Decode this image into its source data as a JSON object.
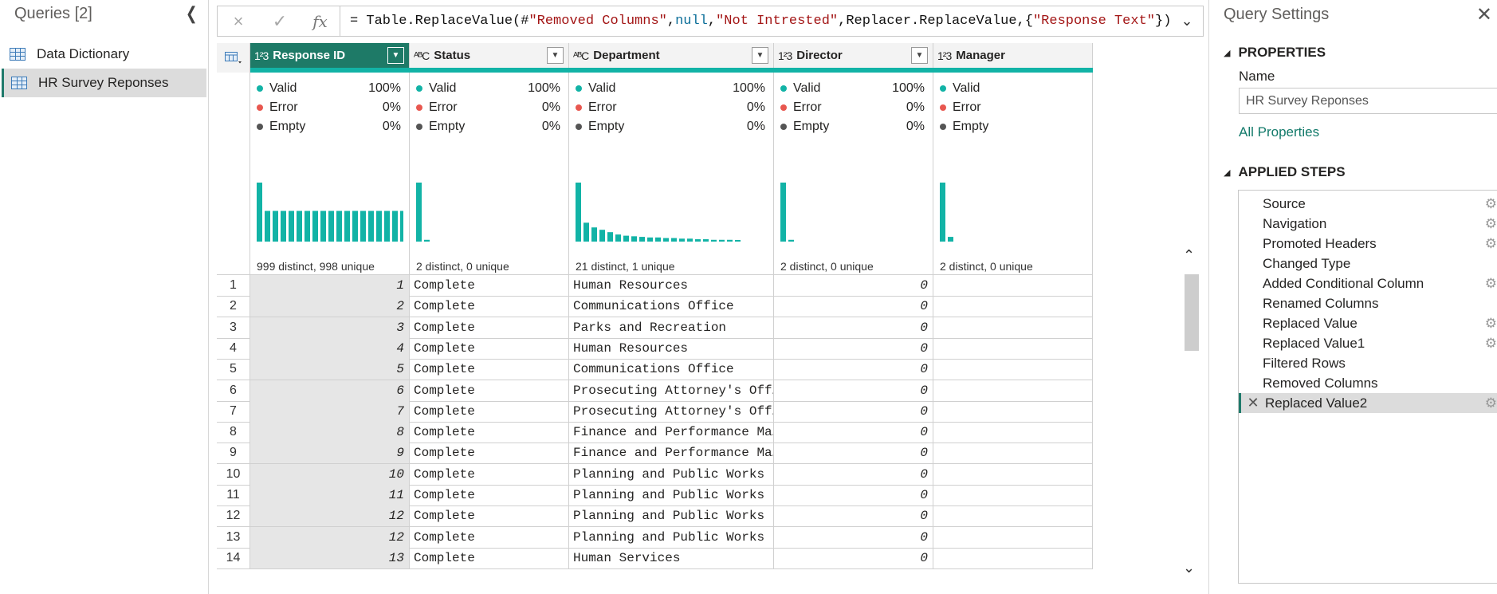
{
  "queries": {
    "title": "Queries [2]",
    "items": [
      {
        "label": "Data Dictionary",
        "selected": false
      },
      {
        "label": "HR Survey Reponses",
        "selected": true
      }
    ]
  },
  "formula_bar": {
    "cancel_icon": "×",
    "confirm_icon": "✓",
    "fx_label": "fx",
    "formula": "= Table.ReplaceValue(#\"Removed Columns\",null,\"Not Intrested\",Replacer.ReplaceValue,{\"Response Text\"})",
    "formula_parts": [
      {
        "t": "= Table.ReplaceValue(#",
        "c": ""
      },
      {
        "t": "\"Removed Columns\"",
        "c": "str"
      },
      {
        "t": ",",
        "c": ""
      },
      {
        "t": "null",
        "c": "kw"
      },
      {
        "t": ",",
        "c": ""
      },
      {
        "t": "\"Not Intrested\"",
        "c": "str"
      },
      {
        "t": ",Replacer.ReplaceValue,{",
        "c": ""
      },
      {
        "t": "\"Response Text\"",
        "c": "str"
      },
      {
        "t": "})",
        "c": ""
      }
    ]
  },
  "columns": [
    {
      "type_icon": "1²3",
      "name": "Response ID",
      "selected": true,
      "valid": "100%",
      "error": "0%",
      "empty": "0%",
      "distinct": "999 distinct, 998 unique",
      "histogram": [
        1.0,
        0.52,
        0.52,
        0.52,
        0.52,
        0.52,
        0.52,
        0.52,
        0.52,
        0.52,
        0.52,
        0.52,
        0.52,
        0.52,
        0.52,
        0.52,
        0.52,
        0.52,
        0.52,
        0.52
      ]
    },
    {
      "type_icon": "ᴬᴮC",
      "name": "Status",
      "selected": false,
      "valid": "100%",
      "error": "0%",
      "empty": "0%",
      "distinct": "2 distinct, 0 unique",
      "histogram": [
        1.0,
        0.03
      ]
    },
    {
      "type_icon": "ᴬᴮC",
      "name": "Department",
      "selected": false,
      "valid": "100%",
      "error": "0%",
      "empty": "0%",
      "distinct": "21 distinct, 1 unique",
      "histogram": [
        1.0,
        0.32,
        0.24,
        0.2,
        0.16,
        0.12,
        0.1,
        0.09,
        0.08,
        0.07,
        0.07,
        0.06,
        0.06,
        0.05,
        0.05,
        0.04,
        0.04,
        0.03,
        0.03,
        0.03,
        0.02
      ]
    },
    {
      "type_icon": "1²3",
      "name": "Director",
      "selected": false,
      "valid": "100%",
      "error": "0%",
      "empty": "0%",
      "distinct": "2 distinct, 0 unique",
      "histogram": [
        1.0,
        0.03
      ]
    },
    {
      "type_icon": "1²3",
      "name": "Manager",
      "selected": false,
      "valid": "",
      "error": "",
      "empty": "",
      "distinct": "2 distinct, 0 unique",
      "histogram": [
        1.0,
        0.08
      ]
    }
  ],
  "profile_labels": {
    "valid": "Valid",
    "error": "Error",
    "empty": "Empty"
  },
  "rows": [
    {
      "n": "1",
      "id": "1",
      "status": "Complete",
      "dept": "Human Resources",
      "director": "0"
    },
    {
      "n": "2",
      "id": "2",
      "status": "Complete",
      "dept": "Communications Office",
      "director": "0"
    },
    {
      "n": "3",
      "id": "3",
      "status": "Complete",
      "dept": "Parks and Recreation",
      "director": "0"
    },
    {
      "n": "4",
      "id": "4",
      "status": "Complete",
      "dept": "Human Resources",
      "director": "0"
    },
    {
      "n": "5",
      "id": "5",
      "status": "Complete",
      "dept": "Communications Office",
      "director": "0"
    },
    {
      "n": "6",
      "id": "6",
      "status": "Complete",
      "dept": "Prosecuting Attorney's Off…",
      "director": "0"
    },
    {
      "n": "7",
      "id": "7",
      "status": "Complete",
      "dept": "Prosecuting Attorney's Off…",
      "director": "0"
    },
    {
      "n": "8",
      "id": "8",
      "status": "Complete",
      "dept": "Finance and Performance Ma…",
      "director": "0"
    },
    {
      "n": "9",
      "id": "9",
      "status": "Complete",
      "dept": "Finance and Performance Ma…",
      "director": "0"
    },
    {
      "n": "10",
      "id": "10",
      "status": "Complete",
      "dept": "Planning and Public Works",
      "director": "0"
    },
    {
      "n": "11",
      "id": "11",
      "status": "Complete",
      "dept": "Planning and Public Works",
      "director": "0"
    },
    {
      "n": "12",
      "id": "12",
      "status": "Complete",
      "dept": "Planning and Public Works",
      "director": "0"
    },
    {
      "n": "13",
      "id": "12",
      "status": "Complete",
      "dept": "Planning and Public Works",
      "director": "0"
    },
    {
      "n": "14",
      "id": "13",
      "status": "Complete",
      "dept": "Human Services",
      "director": "0"
    }
  ],
  "settings": {
    "title": "Query Settings",
    "properties_label": "PROPERTIES",
    "name_label": "Name",
    "name_value": "HR Survey Reponses",
    "all_properties": "All Properties",
    "applied_steps_label": "APPLIED STEPS",
    "steps": [
      {
        "label": "Source",
        "gear": true,
        "selected": false
      },
      {
        "label": "Navigation",
        "gear": true,
        "selected": false
      },
      {
        "label": "Promoted Headers",
        "gear": true,
        "selected": false
      },
      {
        "label": "Changed Type",
        "gear": false,
        "selected": false
      },
      {
        "label": "Added Conditional Column",
        "gear": true,
        "selected": false
      },
      {
        "label": "Renamed Columns",
        "gear": false,
        "selected": false
      },
      {
        "label": "Replaced Value",
        "gear": true,
        "selected": false
      },
      {
        "label": "Replaced Value1",
        "gear": true,
        "selected": false
      },
      {
        "label": "Filtered Rows",
        "gear": false,
        "selected": false
      },
      {
        "label": "Removed Columns",
        "gear": false,
        "selected": false
      },
      {
        "label": "Replaced Value2",
        "gear": true,
        "selected": true
      }
    ]
  },
  "colors": {
    "accent": "#1e7a67",
    "profile_bar": "#12b3a6",
    "valid_dot": "#12b3a6",
    "error_dot": "#e8574f",
    "empty_dot": "#555555"
  }
}
